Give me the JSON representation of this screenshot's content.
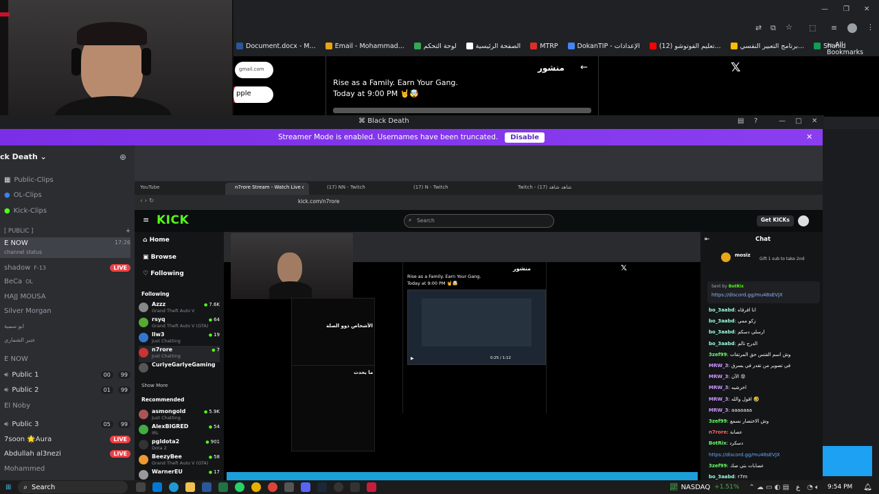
{
  "browser": {
    "bookmarks": [
      {
        "label": "Document.docx - M...",
        "color": "#2b579a"
      },
      {
        "label": "Email - Mohammad...",
        "color": "#e8a317"
      },
      {
        "label": "لوحة التحكم",
        "color": "#34a853"
      },
      {
        "label": "الصفحة الرئيسية",
        "color": "#fff"
      },
      {
        "label": "MTRP",
        "color": "#d93025"
      },
      {
        "label": "DokanTIP - الإعدادات",
        "color": "#4285f4"
      },
      {
        "label": "(12) تعليم الفوتوشو...",
        "color": "#ff0000"
      },
      {
        "label": "برنامج التعبير النفسي...",
        "color": "#fbbc04"
      },
      {
        "label": "Shahid",
        "color": "#0f9d58"
      }
    ],
    "all_bookmarks": "All Bookmarks"
  },
  "tweet": {
    "header": "منشور",
    "line1": "Rise as a Family. Earn Your Gang.",
    "line2": "Today at 9:00 PM 🤘🤯",
    "side_email": "gmail.com",
    "side_apple": "pple"
  },
  "discord": {
    "window_title": "Black Death",
    "banner_text": "Streamer Mode is enabled. Usernames have been truncated.",
    "banner_button": "Disable",
    "server_name": "ck Death",
    "channels": [
      "Public-Clips",
      "OL-Clips",
      "Kick-Clips"
    ],
    "category_public": "[ PUBLIC ]",
    "category_now1": "E NOW",
    "now_time": "17:26",
    "channel_status": "channel status",
    "members1": [
      {
        "name": "shadow",
        "tag": "F-13",
        "live": "LIVE"
      },
      {
        "name": "BeCa",
        "tag": "OL",
        "live": ""
      },
      {
        "name": "HAJJ MOUSA",
        "tag": "",
        "live": ""
      },
      {
        "name": "Silver Morgan",
        "tag": "",
        "live": ""
      },
      {
        "name": "ابو سمية",
        "tag": "",
        "live": ""
      },
      {
        "name": "عنبر الشماري",
        "tag": "",
        "live": ""
      }
    ],
    "category_now2": "E NOW",
    "voice": [
      {
        "name": "Public 1",
        "a": "00",
        "b": "99"
      },
      {
        "name": "Public 2",
        "a": "01",
        "b": "99"
      }
    ],
    "el_noby": "El Noby",
    "public3": {
      "name": "Public 3",
      "a": "05",
      "b": "99"
    },
    "members2": [
      {
        "name": "7soon 🌟Aura",
        "live": "LIVE"
      },
      {
        "name": "Abdullah al3nezi",
        "live": "LIVE"
      },
      {
        "name": "Mohammed",
        "live": ""
      }
    ]
  },
  "stream": {
    "tabs": [
      "YouTube",
      "n7rore Stream - Watch Live on K",
      "(17) NN - Twitch",
      "(17) N - Twitch",
      "Twitch - (17) شاهد شاهد"
    ],
    "url": "kick.com/n7rore",
    "logo": "KICK",
    "search_placeholder": "Search",
    "get_kicks": "Get KICKs",
    "nav": [
      "Home",
      "Browse",
      "Following"
    ],
    "following_label": "Following",
    "following": [
      {
        "name": "Azzz",
        "game": "Grand Theft Auto V",
        "viewers": "7.6K",
        "color": "#888"
      },
      {
        "name": "rsyq",
        "game": "Grand Theft Auto V (GTA)",
        "viewers": "64",
        "color": "#5a3"
      },
      {
        "name": "llw3",
        "game": "Just Chatting",
        "viewers": "19",
        "color": "#37c"
      },
      {
        "name": "n7rore",
        "game": "Just Chatting",
        "viewers": "7",
        "color": "#c33"
      },
      {
        "name": "CuriyeGarlyeGaming",
        "game": "",
        "viewers": "",
        "color": "#555"
      }
    ],
    "show_more": "Show More",
    "recommended_label": "Recommended",
    "recommended": [
      {
        "name": "asmongold",
        "game": "Just Chatting",
        "viewers": "5.9K",
        "color": "#a55"
      },
      {
        "name": "AlexBIGRED",
        "game": "IRL",
        "viewers": "54",
        "color": "#4a4"
      },
      {
        "name": "pgldota2",
        "game": "Dota 2",
        "viewers": "901",
        "color": "#333"
      },
      {
        "name": "BeezyBee",
        "game": "Grand Theft Auto V (GTA)",
        "viewers": "58",
        "color": "#e93"
      },
      {
        "name": "WarnerEU",
        "game": "",
        "viewers": "17",
        "color": "#999"
      }
    ],
    "chat_title": "Chat",
    "sub_user": "mosiz",
    "sub_text": "Gift 1 sub to take 2nd",
    "pinned_by": "Sent by",
    "pinned_user": "BotRix",
    "pinned_link": "https://discord.gg/mu48sEVJX",
    "inner_header": "منشور",
    "inner_line1": "Rise as a Family. Earn Your Gang.",
    "inner_line2": "Today at 9:00 PM 🤘🤯",
    "inner_heading": "الأشخاص ذوو الصلة",
    "inner_trends": "ما يحدث",
    "video_time": "0:25 / 1:12",
    "chat": [
      {
        "user": "bo_3aabd",
        "msg": "انا افرقاه",
        "color": "#9fd"
      },
      {
        "user": "bo_3aabd",
        "msg": "زكو ممي",
        "color": "#9fd"
      },
      {
        "user": "bo_3aabd",
        "msg": "ارسلي دسكم",
        "color": "#9fd"
      },
      {
        "user": "bo_3aabd",
        "msg": "الدرج تالم",
        "color": "#9fd"
      },
      {
        "user": "3zef99",
        "msg": "وش اسم الفتس حق المرتقات",
        "color": "#6f6"
      },
      {
        "user": "MRW_3",
        "msg": "في تصوير من تقدر في يسرق",
        "color": "#c9f"
      },
      {
        "user": "MRW_3",
        "msg": "الآن 😵",
        "color": "#c9f"
      },
      {
        "user": "MRW_3",
        "msg": "اخرشيه",
        "color": "#c9f"
      },
      {
        "user": "MRW_3",
        "msg": "اقول والله 🤣",
        "color": "#c9f"
      },
      {
        "user": "MRW_3",
        "msg": "aaaaaaa",
        "color": "#c9f"
      },
      {
        "user": "3zef99",
        "msg": "وش الاختصار نسمع",
        "color": "#6f6"
      },
      {
        "user": "n7rore",
        "msg": "عصابة",
        "color": "#f66"
      },
      {
        "user": "BotRix",
        "msg": "دسكرد",
        "color": "#6f6"
      },
      {
        "user": "",
        "msg": "https://discord.gg/mu48sEVJX",
        "color": "#6af"
      },
      {
        "user": "3zef99",
        "msg": "عصابات بتي صك",
        "color": "#6f6"
      },
      {
        "user": "bo_3aabd",
        "msg": "r7m",
        "color": "#9fd"
      }
    ]
  },
  "taskbar": {
    "search": "Search",
    "ticker": "NASDAQ",
    "ticker_change": "+1.51%",
    "time": "9:54 PM",
    "lang": "ع"
  }
}
